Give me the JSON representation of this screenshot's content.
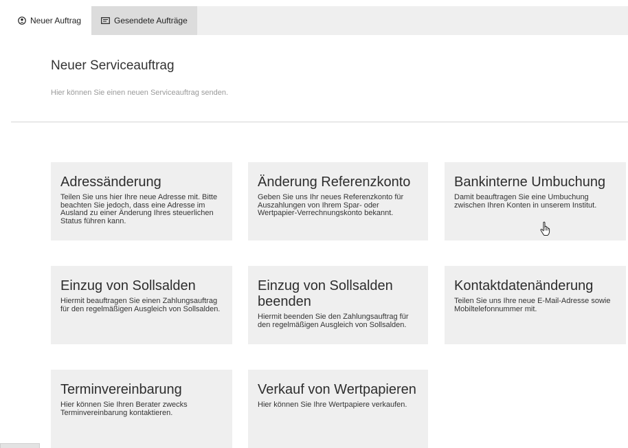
{
  "tabs": {
    "new_order": {
      "label": "Neuer Auftrag",
      "icon": "user-circle-icon"
    },
    "sent_orders": {
      "label": "Gesendete Aufträge",
      "icon": "envelope-card-icon"
    }
  },
  "header": {
    "title": "Neuer Serviceauftrag",
    "subtitle": "Hier können Sie einen neuen Serviceauftrag senden."
  },
  "tiles": [
    {
      "title": "Adressänderung",
      "desc": "Teilen Sie uns hier Ihre neue Adresse mit. Bitte beachten Sie jedoch, dass eine Adresse im Ausland zu einer Änderung Ihres steuerlichen Status führen kann."
    },
    {
      "title": "Änderung Referenzkonto",
      "desc": "Geben Sie uns Ihr neues Referenzkonto für Auszahlungen von Ihrem Spar- oder Wertpapier-Verrechnungskonto bekannt."
    },
    {
      "title": "Bankinterne Umbuchung",
      "desc": "Damit beauftragen Sie eine Umbuchung zwischen Ihren Konten in unserem Institut."
    },
    {
      "title": "Einzug von Sollsalden",
      "desc": "Hiermit beauftragen Sie einen Zahlungsauftrag für den regelmäßigen Ausgleich von Sollsalden."
    },
    {
      "title": "Einzug von Sollsalden beenden",
      "desc": "Hiermit beenden Sie den Zahlungsauftrag für den regelmäßigen Ausgleich von Sollsalden."
    },
    {
      "title": "Kontaktdatenänderung",
      "desc": "Teilen Sie uns Ihre neue E-Mail-Adresse sowie Mobiltelefonnummer mit."
    },
    {
      "title": "Terminvereinbarung",
      "desc": "Hier können Sie Ihren Berater zwecks Terminvereinbarung kontaktieren."
    },
    {
      "title": "Verkauf von Wertpapieren",
      "desc": "Hier können Sie Ihre Wertpapiere verkaufen."
    }
  ],
  "colors": {
    "tile_bg": "#efefef",
    "tab_bar_bg": "#efefef",
    "inactive_tab_bg": "#dcdcdc",
    "subtitle": "#9a9a9a"
  }
}
